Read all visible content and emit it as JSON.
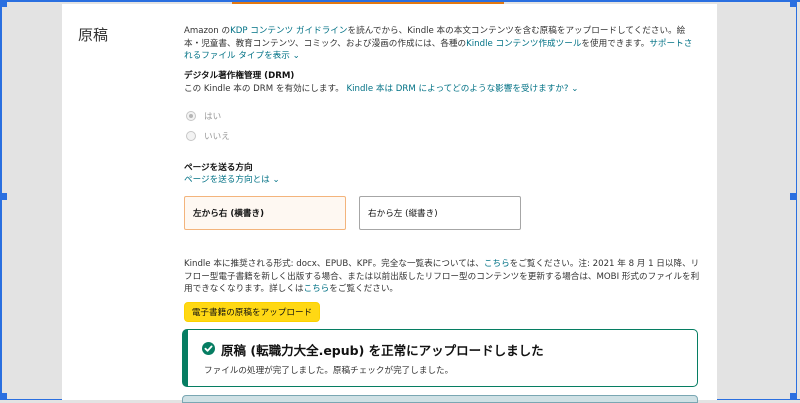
{
  "section": {
    "title": "原稿"
  },
  "intro": {
    "text_1": "Amazon の",
    "link_1": "KDP コンテンツ ガイドライン",
    "text_2": "を読んでから、Kindle 本の本文コンテンツを含む原稿をアップロードしてください。絵本・児童書、教育コンテンツ、コミック、および漫画の作成には、各種の",
    "link_2": "Kindle コンテンツ作成ツール",
    "text_3": "を使用できます。",
    "link_3": "サポートされるファイル タイプを表示",
    "link_3_suffix": "⌄"
  },
  "drm": {
    "heading": "デジタル著作権管理 (DRM)",
    "text": "この Kindle 本の DRM を有効にします。",
    "link": "Kindle 本は DRM によってどのような影響を受けますか?",
    "link_suffix": "⌄",
    "options": [
      {
        "label": "はい",
        "selected": true
      },
      {
        "label": "いいえ",
        "selected": false
      }
    ]
  },
  "page_direction": {
    "heading": "ページを送る方向",
    "link": "ページを送る方向とは",
    "link_suffix": "⌄",
    "options": [
      {
        "label": "左から右 (横書き)",
        "selected": true
      },
      {
        "label": "右から左 (縦書き)",
        "selected": false
      }
    ]
  },
  "formats": {
    "text_1": "Kindle 本に推奨される形式: docx、EPUB、KPF。完全な一覧表については、",
    "link_1": "こちら",
    "text_2": "をご覧ください。注: 2021 年 8 月 1 日以降、リフロー型電子書籍を新しく出版する場合、または以前出版したリフロー型のコンテンツを更新する場合は、MOBI 形式のファイルを利用できなくなります。詳しくは",
    "link_2": "こちら",
    "text_3": "をご覧ください。"
  },
  "upload_button": {
    "label": "電子書籍の原稿をアップロード"
  },
  "success_alert": {
    "title": "原稿 (転職力大全.epub) を正常にアップロードしました",
    "body": "ファイルの処理が完了しました。原稿チェックが完了しました。",
    "icon": "check-circle-icon",
    "color": "#067d62"
  },
  "colors": {
    "link": "#007185",
    "primary_button": "#ffd814",
    "selection_frame": "#2a6fe0",
    "accent": "#e47911"
  }
}
